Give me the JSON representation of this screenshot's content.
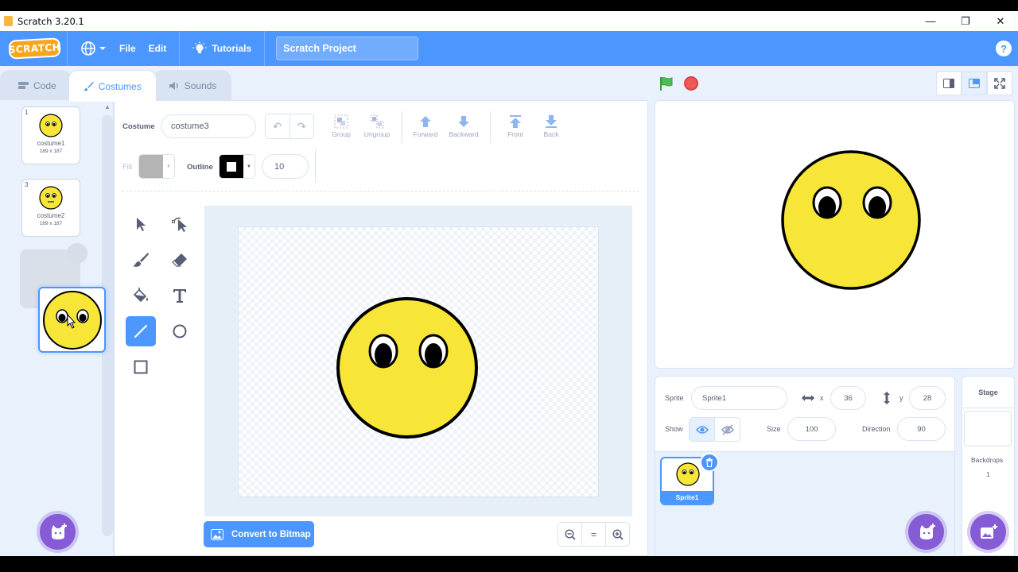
{
  "window": {
    "title": "Scratch 3.20.1",
    "minimize": "—",
    "maximize": "❐",
    "close": "✕"
  },
  "menu": {
    "logo": "SCRATCH",
    "file": "File",
    "edit": "Edit",
    "tutorials": "Tutorials",
    "project_title": "Scratch Project",
    "help": "?"
  },
  "tabs": [
    {
      "label": "Code"
    },
    {
      "label": "Costumes"
    },
    {
      "label": "Sounds"
    }
  ],
  "costumes": [
    {
      "number": "1",
      "name": "costume1",
      "size": "189 x 187"
    },
    {
      "number": "3",
      "name": "costume2",
      "size": "189 x 187"
    }
  ],
  "editor": {
    "costume_label": "Costume",
    "costume_name": "costume3",
    "undo": "↶",
    "redo": "↷",
    "group": "Group",
    "ungroup": "Ungroup",
    "forward": "Forward",
    "backward": "Backward",
    "front": "Front",
    "back": "Back",
    "fill_label": "Fill",
    "outline_label": "Outline",
    "outline_width": "10",
    "fill_color": "#b4b4b4",
    "outline_color": "#000000",
    "convert_button": "Convert to Bitmap",
    "zoom_out": "−",
    "zoom_reset": "=",
    "zoom_in": "+"
  },
  "sprite": {
    "sprite_label": "Sprite",
    "sprite_name": "Sprite1",
    "x_label": "x",
    "x": "36",
    "y_label": "y",
    "y": "28",
    "show_label": "Show",
    "size_label": "Size",
    "size": "100",
    "direction_label": "Direction",
    "direction": "90",
    "tile_name": "Sprite1"
  },
  "stage_panel": {
    "title": "Stage",
    "backdrops_label": "Backdrops",
    "backdrops_count": "1"
  },
  "colors": {
    "accent": "#4c97ff",
    "face_fill": "#f7e538",
    "add_button": "#855cd6",
    "flag": "#4cbf56",
    "stop": "#ec5959"
  }
}
